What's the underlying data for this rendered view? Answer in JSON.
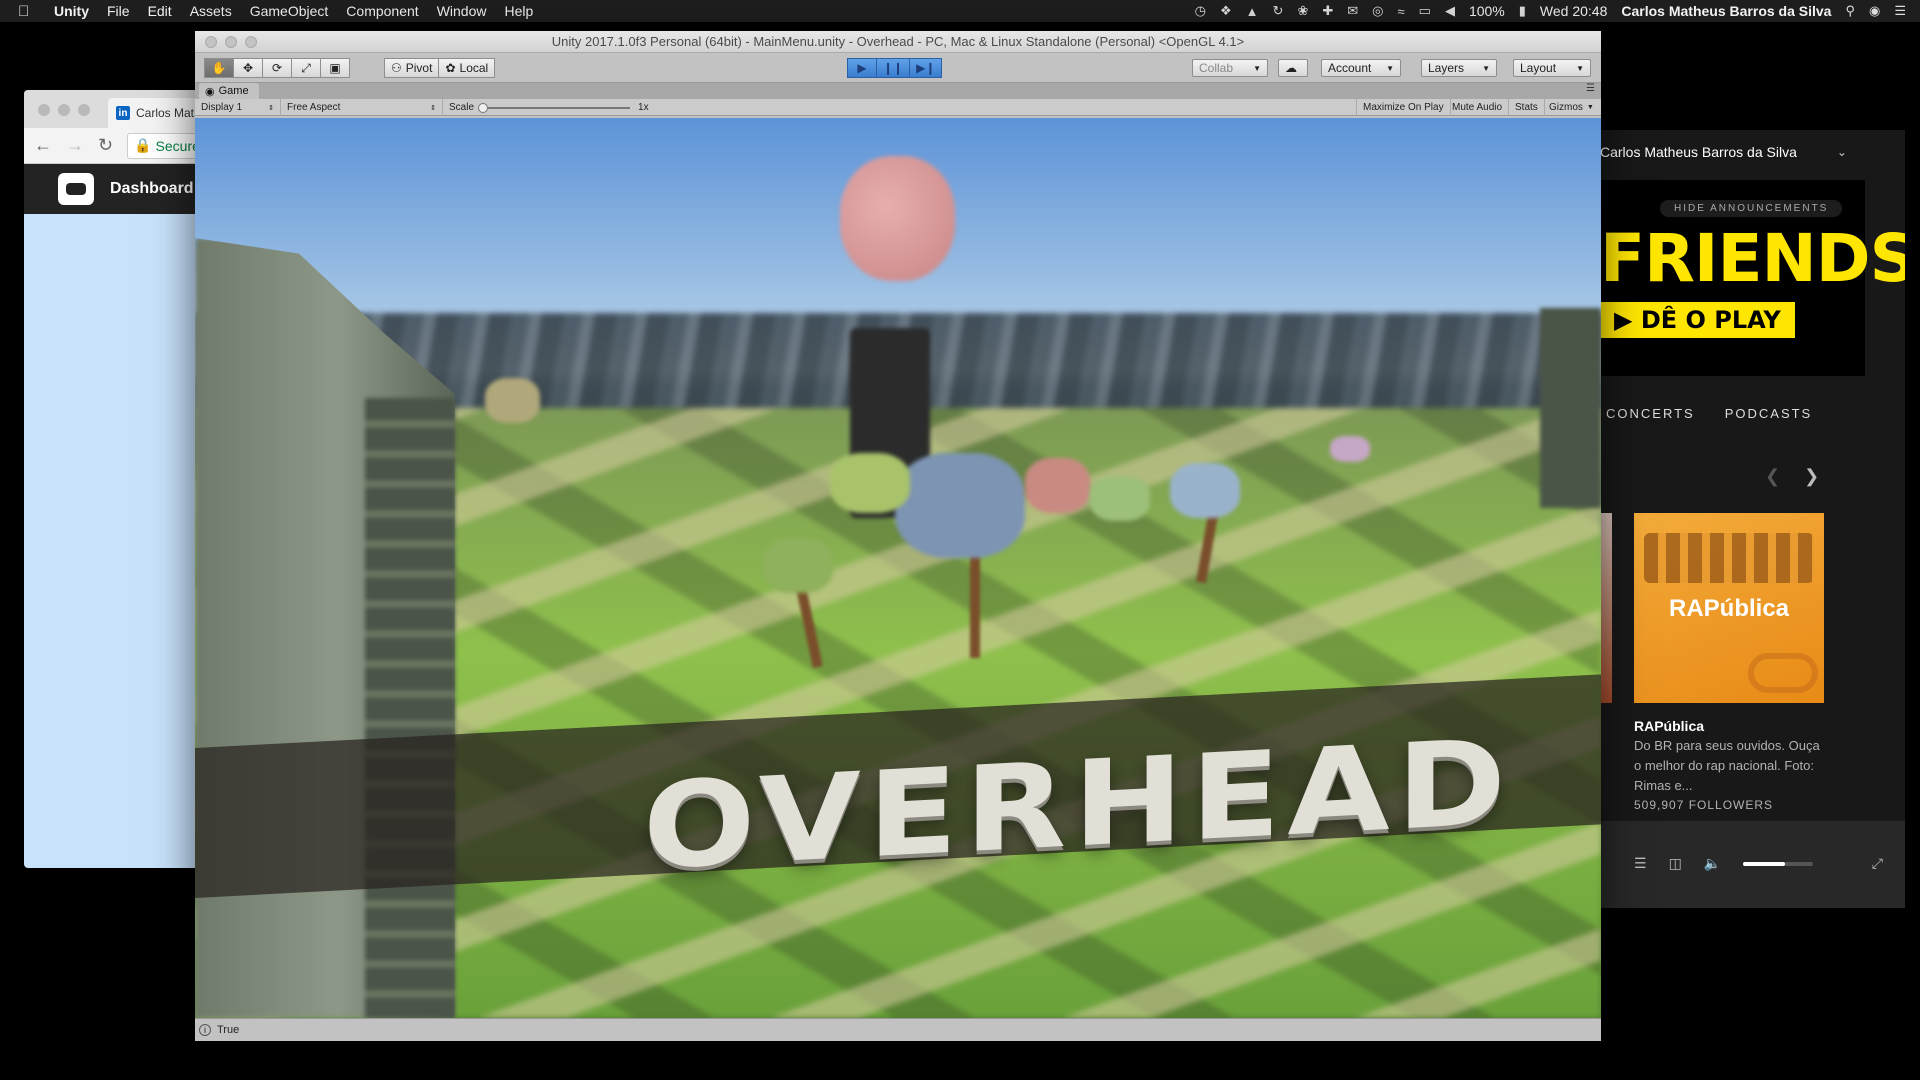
{
  "menubar": {
    "app": "Unity",
    "menus": [
      "File",
      "Edit",
      "Assets",
      "GameObject",
      "Component",
      "Window",
      "Help"
    ],
    "battery": "100%",
    "clock": "Wed 20:48",
    "user": "Carlos Matheus Barros da Silva"
  },
  "browser": {
    "tab_title": "Carlos Mat",
    "secure_label": "Secure",
    "page_title": "Dashboard"
  },
  "spotify": {
    "user": "Carlos Matheus Barros da Silva",
    "hide_announcements": "HIDE ANNOUNCEMENTS",
    "banner_title": "FRIENDS",
    "banner_cta": "DÊ O PLAY",
    "tabs": [
      "CONCERTS",
      "PODCASTS"
    ],
    "card": {
      "image_text": "RAPública",
      "title": "RAPública",
      "description": "Do BR para seus ouvidos. Ouça o melhor do rap nacional. Foto: Rimas e...",
      "followers": "509,907 FOLLOWERS"
    },
    "volume_level": 0.6
  },
  "unity": {
    "window_title": "Unity 2017.1.0f3 Personal (64bit) - MainMenu.unity - Overhead - PC, Mac & Linux Standalone (Personal) <OpenGL 4.1>",
    "pivot_label": "Pivot",
    "local_label": "Local",
    "collab_label": "Collab",
    "account_label": "Account",
    "layers_label": "Layers",
    "layout_label": "Layout",
    "game_tab": "Game",
    "display": "Display 1",
    "aspect": "Free Aspect",
    "scale_label": "Scale",
    "scale_value": "1x",
    "maximize_on_play": "Maximize On Play",
    "mute_audio": "Mute Audio",
    "stats": "Stats",
    "gizmos": "Gizmos",
    "game_logo": "OVERHEAD",
    "status_text": "True"
  }
}
